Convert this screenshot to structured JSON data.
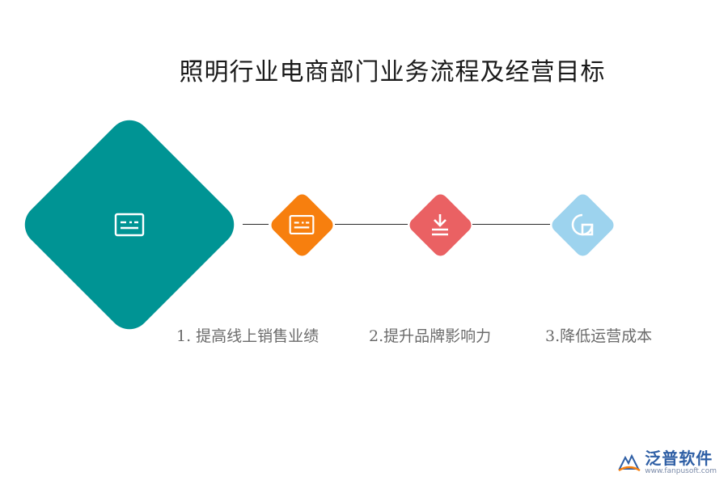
{
  "title": "照明行业电商部门业务流程及经营目标",
  "colors": {
    "main": "#009494",
    "step1": "#f77f0e",
    "step2": "#ea6163",
    "step3": "#9dd3ee",
    "connector": "#2b2b2b",
    "label": "#6b6b6b"
  },
  "nodes": [
    {
      "name": "main-node",
      "icon": "id-card-icon"
    },
    {
      "name": "step-1-node",
      "icon": "id-card-icon"
    },
    {
      "name": "step-2-node",
      "icon": "download-tray-icon"
    },
    {
      "name": "step-3-node",
      "icon": "chart-square-icon"
    }
  ],
  "labels": [
    "1.  提高线上销售业绩",
    "2.提升品牌影响力",
    "3.降低运营成本"
  ],
  "watermark": {
    "brand": "泛普软件",
    "url": "www.fanpusoft.com"
  }
}
